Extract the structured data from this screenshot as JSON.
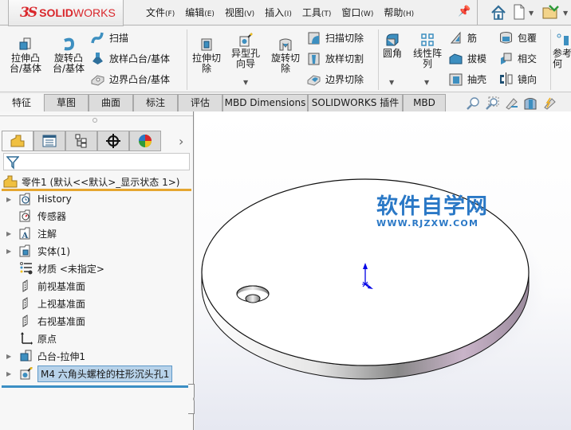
{
  "app": {
    "logo_prefix": "3S",
    "logo_bold": "SOLID",
    "logo_light": "WORKS"
  },
  "menu": [
    {
      "label": "文件",
      "key": "(F)"
    },
    {
      "label": "编辑",
      "key": "(E)"
    },
    {
      "label": "视图",
      "key": "(V)"
    },
    {
      "label": "插入",
      "key": "(I)"
    },
    {
      "label": "工具",
      "key": "(T)"
    },
    {
      "label": "窗口",
      "key": "(W)"
    },
    {
      "label": "帮助",
      "key": "(H)"
    }
  ],
  "quick_access": [
    "home-icon",
    "new-document-icon",
    "open-icon"
  ],
  "ribbon": {
    "extrude_boss": "拉伸凸\n台/基体",
    "revolve_boss": "旋转凸\n台/基体",
    "sweep": "扫描",
    "loft": "放样凸台/基体",
    "boundary_boss": "边界凸台/基体",
    "extrude_cut": "拉伸切\n除",
    "hole_wizard": "异型孔\n向导",
    "revolve_cut": "旋转切\n除",
    "swept_cut": "扫描切除",
    "lofted_cut": "放样切割",
    "boundary_cut": "边界切除",
    "fillet": "圆角",
    "linear_pattern": "线性阵\n列",
    "rib": "筋",
    "draft": "拔模",
    "shell": "抽壳",
    "wrap": "包覆",
    "intersect": "相交",
    "mirror": "镜向",
    "ref_geometry": "参考几\n何"
  },
  "tabs": [
    {
      "label": "特征",
      "active": true
    },
    {
      "label": "草图",
      "active": false
    },
    {
      "label": "曲面",
      "active": false
    },
    {
      "label": "标注",
      "active": false
    },
    {
      "label": "评估",
      "active": false
    },
    {
      "label": "MBD Dimensions",
      "active": false
    },
    {
      "label": "SOLIDWORKS 插件",
      "active": false
    },
    {
      "label": "MBD",
      "active": false
    }
  ],
  "panel": {
    "tabs": [
      "feature-manager-icon",
      "property-manager-icon",
      "configuration-manager-icon",
      "dimxpert-icon",
      "display-manager-icon"
    ],
    "more": "›",
    "root": "零件1  (默认<<默认>_显示状态 1>)",
    "tree": [
      {
        "label": "History",
        "expandable": true,
        "icon": "history-folder-icon"
      },
      {
        "label": "传感器",
        "expandable": false,
        "icon": "sensors-folder-icon"
      },
      {
        "label": "注解",
        "expandable": true,
        "icon": "annotations-folder-icon"
      },
      {
        "label": "实体(1)",
        "expandable": true,
        "icon": "solid-bodies-folder-icon"
      },
      {
        "label": "材质 <未指定>",
        "expandable": false,
        "icon": "material-icon"
      },
      {
        "label": "前视基准面",
        "expandable": false,
        "icon": "plane-icon"
      },
      {
        "label": "上视基准面",
        "expandable": false,
        "icon": "plane-icon"
      },
      {
        "label": "右视基准面",
        "expandable": false,
        "icon": "plane-icon"
      },
      {
        "label": "原点",
        "expandable": false,
        "icon": "origin-icon"
      },
      {
        "label": "凸台-拉伸1",
        "expandable": true,
        "icon": "boss-extrude-icon"
      },
      {
        "label": "M4 六角头螺栓的柱形沉头孔1",
        "expandable": true,
        "icon": "hole-wizard-icon",
        "selected": true
      }
    ]
  },
  "watermark": {
    "title": "软件自学网",
    "url": "WWW.RJZXW.COM"
  },
  "colors": {
    "accent_orange": "#e5a630",
    "selection_blue": "#3b8fc4",
    "brand_red": "#d9262b",
    "watermark_blue": "#2a78c6"
  }
}
